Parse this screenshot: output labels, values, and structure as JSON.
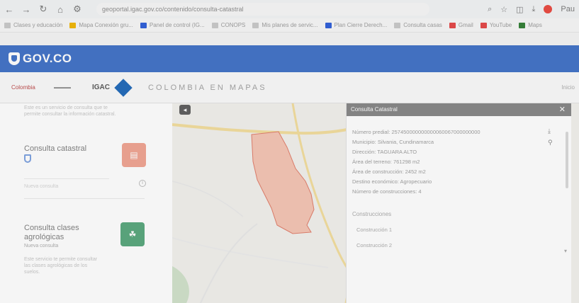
{
  "browser": {
    "url": "geoportal.igac.gov.co/contenido/consulta-catastral",
    "bookmarks": [
      {
        "label": "Clases y educación",
        "color": "grey"
      },
      {
        "label": "Mapa Conexión gru...",
        "color": "yellow"
      },
      {
        "label": "Panel de control (IG...",
        "color": "blue"
      },
      {
        "label": "CONOPS",
        "color": "grey"
      },
      {
        "label": "Mis planes de servic...",
        "color": "grey"
      },
      {
        "label": "Plan Cierre Derech...",
        "color": "blue"
      },
      {
        "label": "Consulta casas",
        "color": "grey"
      },
      {
        "label": "Gmail",
        "color": "red"
      },
      {
        "label": "YouTube",
        "color": "red"
      },
      {
        "label": "Maps",
        "color": "green"
      }
    ],
    "profile_label": "Pau"
  },
  "gov": {
    "brand": "GOV.CO"
  },
  "site": {
    "colombia_logo": "Colombia",
    "igac_label": "IGAC",
    "title": "COLOMBIA EN MAPAS",
    "header_right": "Inicio"
  },
  "sidebar": {
    "intro_text": "Este es un servicio de consulta que te permite consultar la información catastral.",
    "card1_title": "Consulta catastral",
    "card1_sub": "Nueva consulta",
    "card2_title": "Consulta clases agrológicas",
    "card2_sub": "Nueva consulta",
    "card2_desc": "Este servicio te permite consultar las clases agrológicas de los suelos."
  },
  "popup": {
    "title": "Consulta Catastral",
    "rows": [
      "Número predial: 257450000000000060067000000000",
      "Municipio: Silvania, Cundinamarca",
      "Dirección: TAGUARA ALTO",
      "Área del terreno: 761298 m2",
      "Área de construcción: 2452 m2",
      "Destino económico: Agropecuario",
      "Número de construcciones: 4"
    ],
    "section_title": "Construcciones",
    "subitems": [
      "Construcción 1",
      "Construcción 2"
    ]
  },
  "colors": {
    "gov_blue": "#3d6fc6",
    "parcel_fill": "#f4c3b2",
    "parcel_stroke": "#e07a66",
    "road": "#f0d58a",
    "green_badge": "#55a57a",
    "orange_badge": "#f0a28f"
  },
  "icons": {
    "map_toggle": "chevron-left-icon",
    "download": "download-icon",
    "link": "link-icon",
    "close": "close-icon"
  }
}
